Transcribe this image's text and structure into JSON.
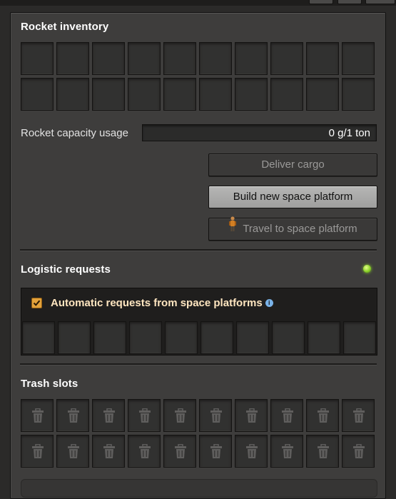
{
  "rocket_inventory": {
    "title": "Rocket inventory",
    "slot_count": 20
  },
  "capacity": {
    "label": "Rocket capacity usage",
    "value": "0 g/1 ton"
  },
  "buttons": {
    "deliver_cargo": "Deliver cargo",
    "build_platform": "Build new space platform",
    "travel_platform": "Travel to space platform"
  },
  "logistic_requests": {
    "title": "Logistic requests",
    "status_color": "#8bd12a",
    "auto_requests_label": "Automatic requests from space platforms",
    "auto_requests_checked": true,
    "info_icon": "i",
    "slot_count": 10
  },
  "trash_slots": {
    "title": "Trash slots",
    "slot_count": 20,
    "icon": "trash-icon"
  },
  "colors": {
    "panel_bg": "#3e3d3c",
    "slot_bg": "#313130",
    "accent_orange": "#e3a23b",
    "request_text": "#ffe6c0"
  }
}
